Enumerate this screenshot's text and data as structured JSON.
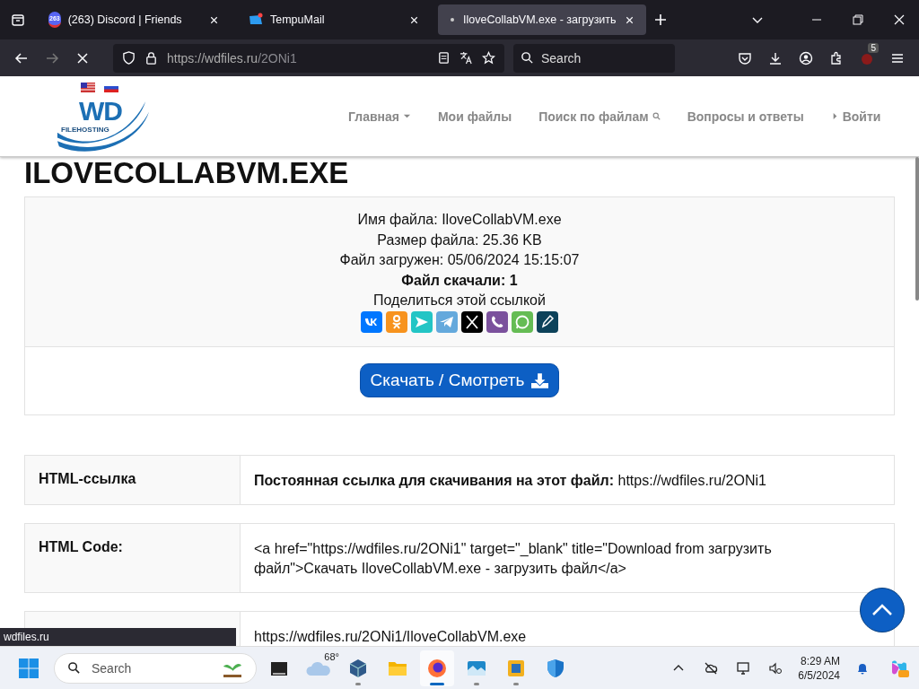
{
  "browser": {
    "tabs": [
      {
        "title": "(263) Discord | Friends",
        "kind": "discord",
        "badge": "263",
        "selected": false
      },
      {
        "title": "TempuMail",
        "kind": "mail",
        "selected": false
      },
      {
        "title": "IloveCollabVM.exe - загрузить",
        "kind": "dot",
        "selected": true
      }
    ],
    "url_host": "https://wdfiles.ru",
    "url_path": "/2ONi1",
    "search_placeholder": "Search",
    "extension_badge": "5",
    "loading": true
  },
  "site": {
    "nav": [
      {
        "label": "Главная",
        "kind": "dropdown"
      },
      {
        "label": "Мои файлы",
        "kind": "plain"
      },
      {
        "label": "Поиск по файлам",
        "kind": "search"
      },
      {
        "label": "Вопросы и ответы",
        "kind": "plain"
      },
      {
        "label": "Войти",
        "kind": "login"
      }
    ],
    "logo_text": "WD",
    "logo_sub": "FILEHOSTING",
    "title": "ILOVECOLLABVM.EXE",
    "info": [
      {
        "text": "Имя файла: IloveCollabVM.exe",
        "bold": false
      },
      {
        "text": "Размер файла: 25.36 KB",
        "bold": false
      },
      {
        "text": "Файл загружен: 05/06/2024 15:15:07",
        "bold": false
      },
      {
        "text": "Файл скачали: 1",
        "bold": true
      },
      {
        "text": "Поделиться этой ссылкой",
        "bold": false
      }
    ],
    "share": [
      {
        "kind": "vk",
        "color": "#0077ff"
      },
      {
        "kind": "ok",
        "color": "#f7931e"
      },
      {
        "kind": "send",
        "color": "#23c5c5"
      },
      {
        "kind": "telegram",
        "color": "#64a9dc"
      },
      {
        "kind": "x",
        "color": "#000000"
      },
      {
        "kind": "viber",
        "color": "#7b519d"
      },
      {
        "kind": "whatsapp",
        "color": "#65bc54"
      },
      {
        "kind": "pen",
        "color": "#0d425a"
      }
    ],
    "download_button": "Скачать / Смотреть",
    "rows": [
      {
        "label": "HTML-ссылка",
        "value": "**Постоянная ссылка для скачивания на этот файл:** https://wdfiles.ru/2ONi1"
      },
      {
        "label": "HTML Code:",
        "value": "<a href=\"https://wdfiles.ru/2ONi1\" target=\"_blank\" title=\"Download from загрузить файл\">Скачать IloveCollabVM.exe - загрузить файл</a>"
      },
      {
        "value": "https://wdfiles.ru/2ONi1/IloveCollabVM.exe"
      }
    ]
  },
  "status_text": "wdfiles.ru",
  "taskbar": {
    "search_placeholder": "Search",
    "weather": "68°",
    "apps": [
      {
        "kind": "vbox",
        "running": true,
        "selected": false
      },
      {
        "kind": "folder",
        "running": false,
        "selected": false
      },
      {
        "kind": "firefox",
        "running": true,
        "selected": true
      },
      {
        "kind": "photos",
        "running": true,
        "selected": false
      },
      {
        "kind": "sandbox",
        "running": true,
        "selected": false
      },
      {
        "kind": "shield",
        "running": false,
        "selected": false
      }
    ],
    "time": "8:29 AM",
    "date": "6/5/2024"
  }
}
